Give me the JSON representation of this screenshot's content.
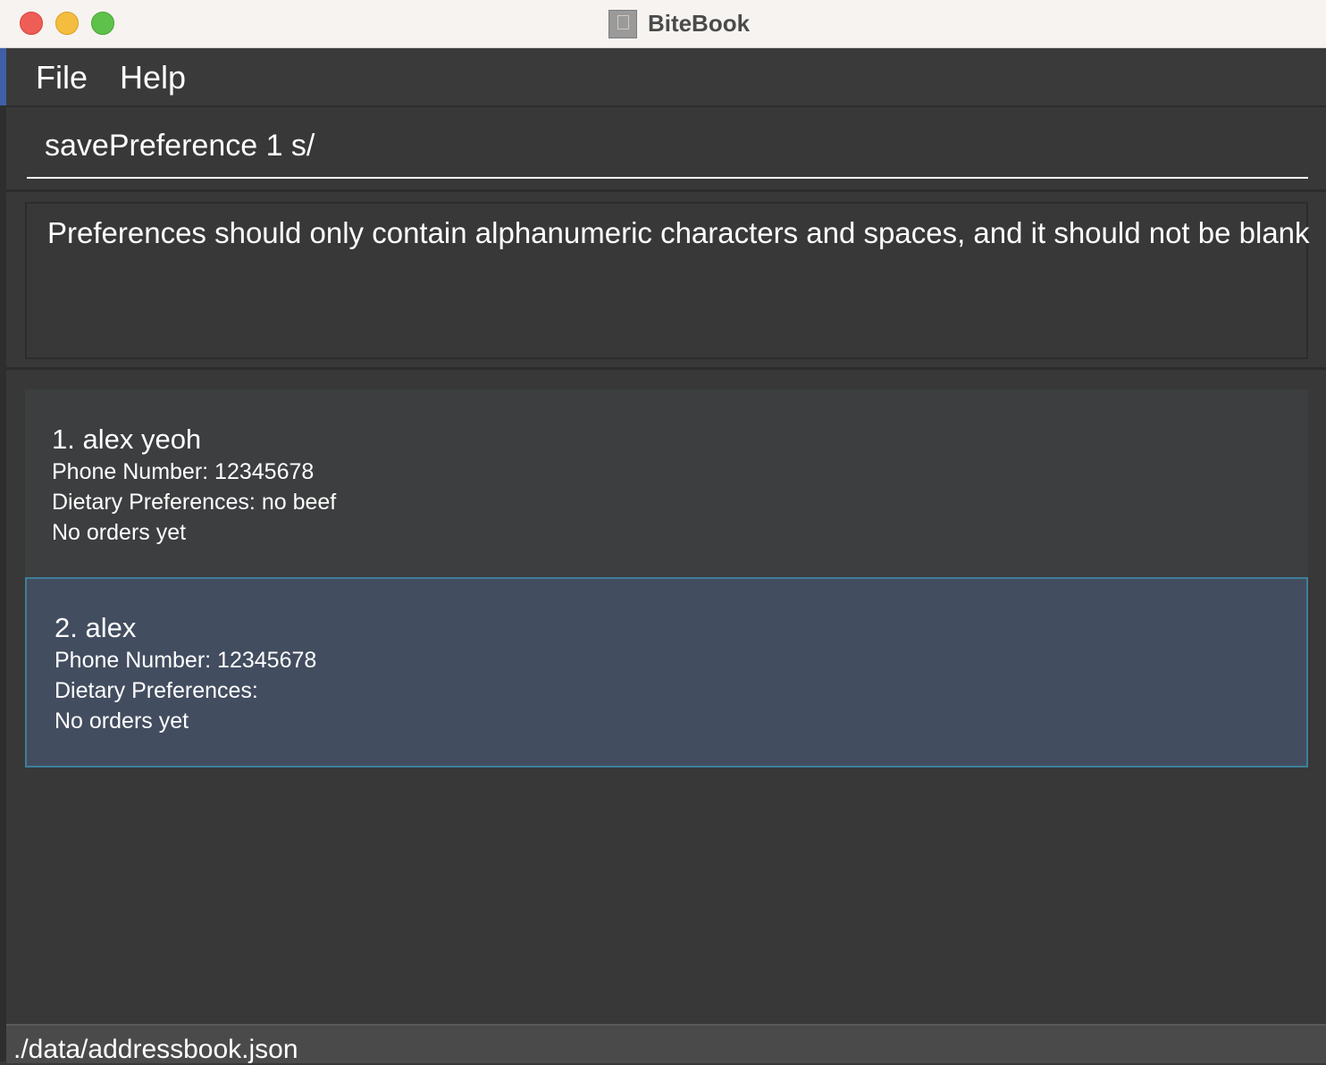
{
  "window": {
    "title": "BiteBook",
    "app_icon": "bitebook-app-icon"
  },
  "menubar": {
    "items": [
      "File",
      "Help"
    ]
  },
  "command_box": {
    "value": "savePreference 1 s/"
  },
  "result_display": {
    "message": "Preferences should only contain alphanumeric characters and spaces, and it should not be blank"
  },
  "person_list": {
    "items": [
      {
        "title": "1. alex yeoh",
        "phone": "Phone Number: 12345678",
        "preferences": "Dietary Preferences: no beef",
        "orders": "No orders yet",
        "selected": false
      },
      {
        "title": "2. alex",
        "phone": "Phone Number: 12345678",
        "preferences": "Dietary Preferences:",
        "orders": "No orders yet",
        "selected": true
      }
    ]
  },
  "statusbar": {
    "path": "./data/addressbook.json"
  },
  "colors": {
    "background": "#383838",
    "selected_card": "#424d5f",
    "selected_border": "#3d7f9a",
    "titlebar": "#f7f3f0"
  }
}
